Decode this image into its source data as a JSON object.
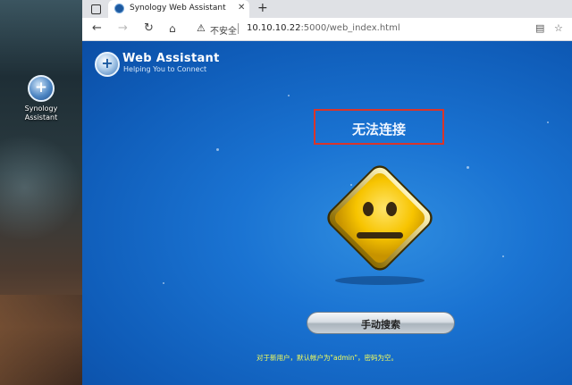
{
  "desktop": {
    "icon": {
      "icon_name": "synology-assistant-icon",
      "label_line1": "Synology",
      "label_line2": "Assistant"
    }
  },
  "browser": {
    "tab": {
      "title": "Synology Web Assistant",
      "close_glyph": "✕"
    },
    "new_tab_glyph": "+",
    "address": {
      "security_label": "不安全",
      "url_host": "10.10.10.22",
      "url_rest": ":5000/web_index.html"
    }
  },
  "page": {
    "brand": {
      "name": "Web Assistant",
      "tagline": "Helping You to Connect"
    },
    "error_title": "无法连接",
    "face_icon": "neutral-face-warning-icon",
    "search_button": "手动搜索",
    "hint": "对于新用户，默认帐户为\"admin\"，密码为空。"
  },
  "colors": {
    "page_bg": "#1a73d2",
    "highlight_border": "#d9352b",
    "hint_text": "#f6ff5a",
    "sign_fill": "#f7c400"
  }
}
